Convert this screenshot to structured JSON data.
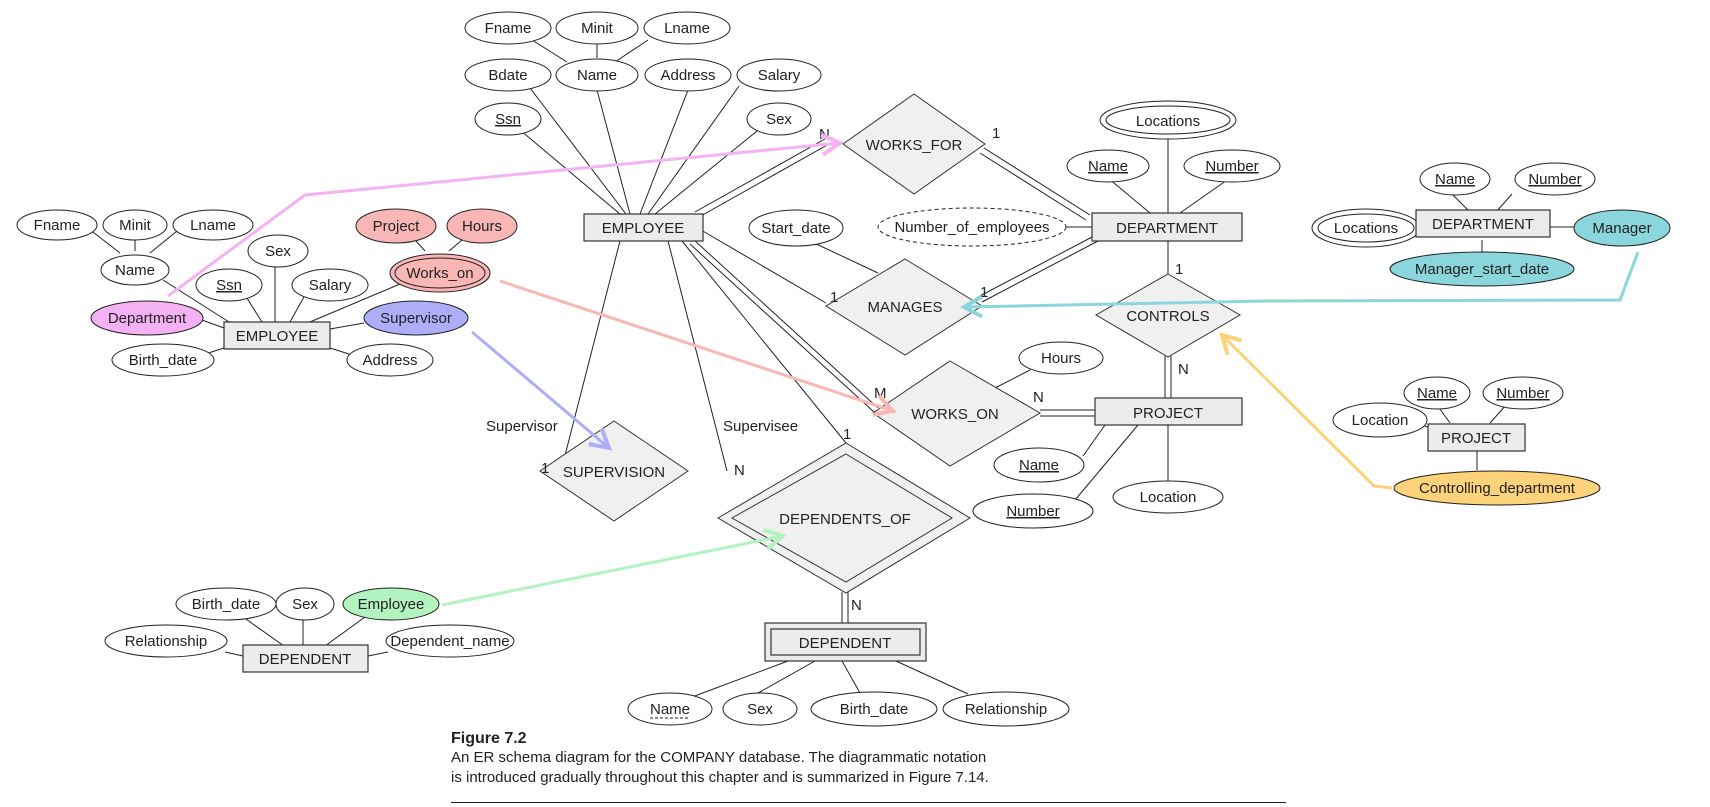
{
  "colors": {
    "department": "#f4b2f4",
    "works_on": "#f9b6b6",
    "supervisor": "#aeaef8",
    "manager": "#8bd6dc",
    "controlling_department": "#fcd27a",
    "employee_fk": "#b3f3c0"
  },
  "caption": {
    "title": "Figure 7.2",
    "line1": "An ER schema diagram for the COMPANY database. The diagrammatic notation",
    "line2": "is introduced gradually throughout this chapter and is summarized in Figure 7.14."
  },
  "main": {
    "entities": {
      "employee": "EMPLOYEE",
      "department": "DEPARTMENT",
      "project": "PROJECT",
      "dependent": "DEPENDENT"
    },
    "relationships": {
      "works_for": "WORKS_FOR",
      "manages": "MANAGES",
      "works_on": "WORKS_ON",
      "controls": "CONTROLS",
      "supervision": "SUPERVISION",
      "dependents_of": "DEPENDENTS_OF"
    },
    "employee_attrs": {
      "fname": "Fname",
      "minit": "Minit",
      "lname": "Lname",
      "bdate": "Bdate",
      "name": "Name",
      "address": "Address",
      "salary": "Salary",
      "ssn": "Ssn",
      "sex": "Sex"
    },
    "department_attrs": {
      "locations": "Locations",
      "name": "Name",
      "number": "Number",
      "number_of_employees": "Number_of_employees"
    },
    "manages_attrs": {
      "start_date": "Start_date"
    },
    "works_on_attrs": {
      "hours": "Hours"
    },
    "project_attrs": {
      "name": "Name",
      "number": "Number",
      "location": "Location"
    },
    "dependent_attrs": {
      "name": "Name",
      "sex": "Sex",
      "birth_date": "Birth_date",
      "relationship": "Relationship"
    },
    "roles": {
      "supervisor": "Supervisor",
      "supervisee": "Supervisee"
    },
    "cardinalities": {
      "works_for_emp": "N",
      "works_for_dept": "1",
      "manages_emp": "1",
      "manages_dept": "1",
      "works_on_emp": "M",
      "works_on_proj": "N",
      "controls_dept": "1",
      "controls_proj": "N",
      "supervision_supervisor": "1",
      "supervision_supervisee": "N",
      "dependents_of_emp": "1",
      "dependents_of_dep": "N"
    }
  },
  "side": {
    "employee": {
      "entity": "EMPLOYEE",
      "attrs": {
        "fname": "Fname",
        "minit": "Minit",
        "lname": "Lname",
        "name": "Name",
        "sex": "Sex",
        "ssn": "Ssn",
        "salary": "Salary",
        "project": "Project",
        "hours": "Hours",
        "works_on": "Works_on",
        "department": "Department",
        "supervisor": "Supervisor",
        "birth_date": "Birth_date",
        "address": "Address"
      }
    },
    "department": {
      "entity": "DEPARTMENT",
      "attrs": {
        "name": "Name",
        "number": "Number",
        "locations": "Locations",
        "manager": "Manager",
        "manager_start_date": "Manager_start_date"
      }
    },
    "project": {
      "entity": "PROJECT",
      "attrs": {
        "name": "Name",
        "number": "Number",
        "location": "Location",
        "controlling_department": "Controlling_department"
      }
    },
    "dependent": {
      "entity": "DEPENDENT",
      "attrs": {
        "birth_date": "Birth_date",
        "sex": "Sex",
        "employee": "Employee",
        "relationship": "Relationship",
        "dependent_name": "Dependent_name"
      }
    }
  }
}
